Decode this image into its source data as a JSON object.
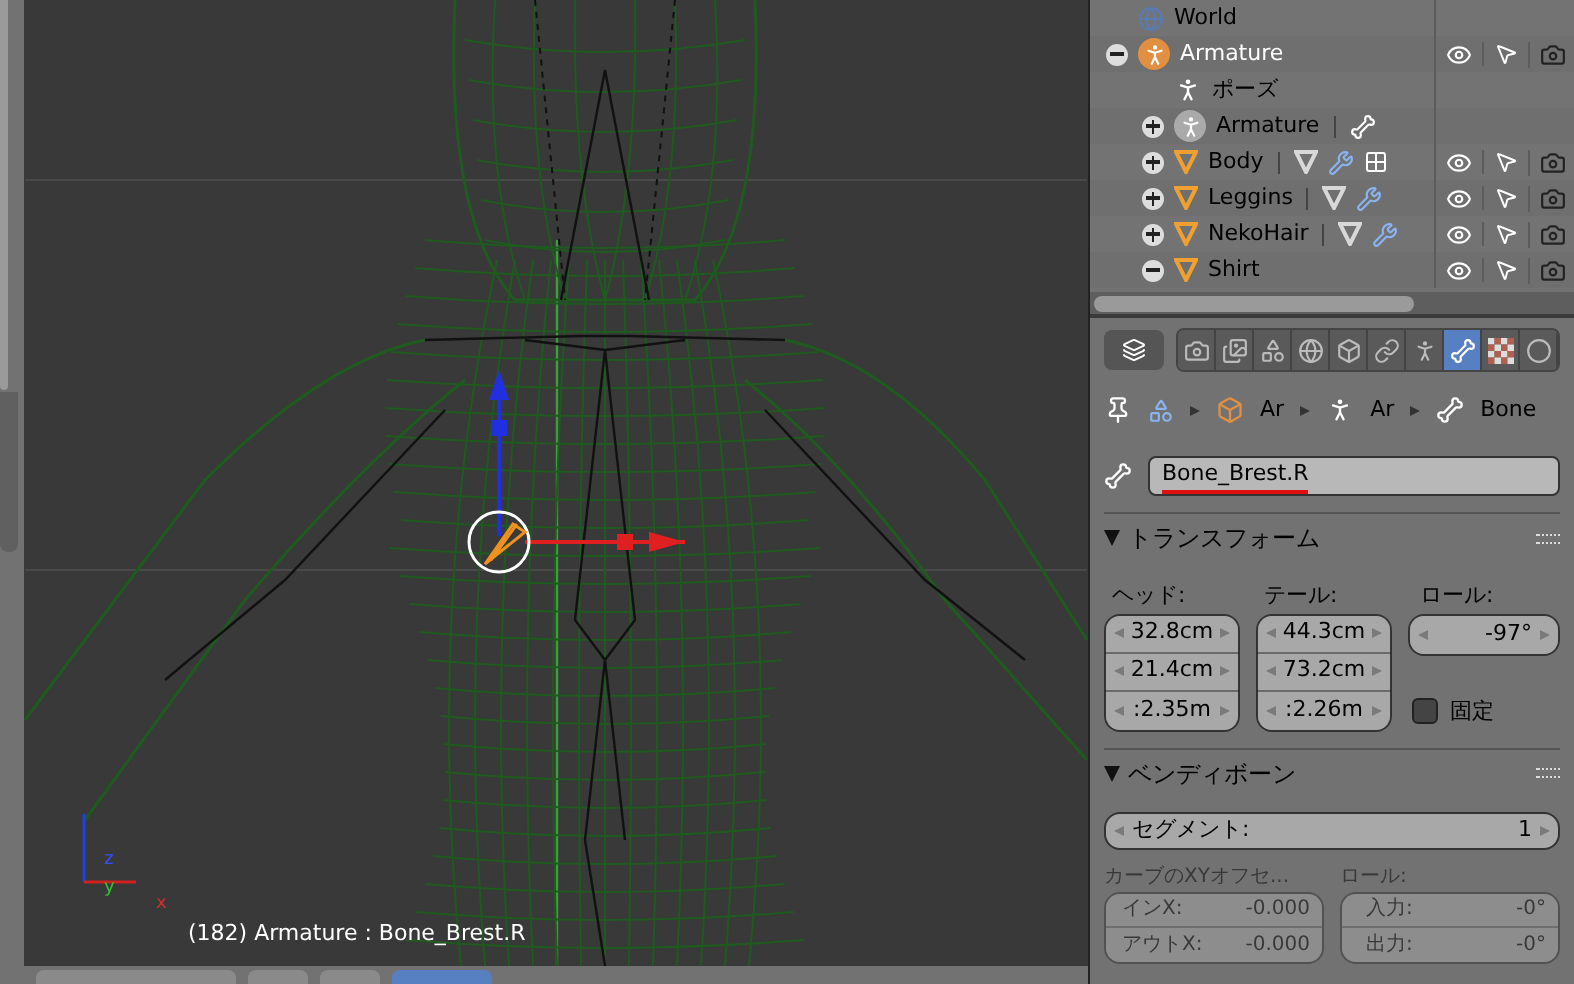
{
  "viewport": {
    "info": "(182) Armature : Bone_Brest.R",
    "axes": [
      "z",
      "y",
      "x"
    ]
  },
  "outliner": {
    "items": [
      {
        "label": "World",
        "kind": "world"
      },
      {
        "label": "Armature",
        "kind": "armature",
        "expanded": true,
        "selected": true,
        "children": [
          {
            "label": "ポーズ",
            "kind": "pose"
          },
          {
            "label": "Armature",
            "kind": "armature_data",
            "expanded": false,
            "extras": [
              {
                "kind": "bone"
              }
            ]
          },
          {
            "label": "Body",
            "kind": "mesh",
            "expanded": false,
            "extras": [
              {
                "kind": "mesh"
              },
              {
                "kind": "modifier"
              },
              {
                "kind": "particles"
              }
            ]
          },
          {
            "label": "Leggins",
            "kind": "mesh",
            "expanded": false,
            "extras": [
              {
                "kind": "mesh"
              },
              {
                "kind": "modifier"
              }
            ]
          },
          {
            "label": "NekoHair",
            "kind": "mesh",
            "expanded": false,
            "extras": [
              {
                "kind": "mesh"
              },
              {
                "kind": "modifier"
              }
            ]
          },
          {
            "label": "Shirt",
            "kind": "mesh",
            "expanded": true
          }
        ]
      }
    ]
  },
  "properties": {
    "tabs": [
      {
        "kind": "render",
        "selected": false
      },
      {
        "kind": "layers",
        "selected": false
      },
      {
        "kind": "scene",
        "selected": false
      },
      {
        "kind": "world",
        "selected": false
      },
      {
        "kind": "object",
        "selected": false
      },
      {
        "kind": "constraints",
        "selected": false
      },
      {
        "kind": "armature",
        "selected": false
      },
      {
        "kind": "bone",
        "selected": true
      },
      {
        "kind": "texture",
        "selected": false
      },
      {
        "kind": "check",
        "selected": false
      }
    ],
    "breadcrumb": [
      {
        "kind": "object",
        "label": "Ar"
      },
      {
        "kind": "armature",
        "label": "Ar"
      },
      {
        "kind": "bone",
        "label": "Bone"
      }
    ],
    "bone_name": "Bone_Brest.R",
    "transform": {
      "title": "トランスフォーム",
      "head_label": "ヘッド:",
      "head": [
        "32.8cm",
        "21.4cm",
        ":2.35m"
      ],
      "tail_label": "テール:",
      "tail": [
        "44.3cm",
        "73.2cm",
        ":2.26m"
      ],
      "roll_label": "ロール:",
      "roll": "-97°",
      "lock": {
        "label": "固定",
        "checked": false
      }
    },
    "bendy_bones": {
      "title": "ベンディボーン",
      "segments": {
        "label": "セグメント:",
        "value": "1"
      },
      "curve_label": "カーブのXYオフセ...",
      "roll_label": "ロール:",
      "disabled": true,
      "curve": [
        {
          "label": "インX:",
          "value": "-0.000"
        },
        {
          "label": "アウトX:",
          "value": "-0.000"
        }
      ],
      "roll": [
        {
          "label": "入力:",
          "value": "-0°"
        },
        {
          "label": "出力:",
          "value": "-0°"
        }
      ]
    }
  }
}
